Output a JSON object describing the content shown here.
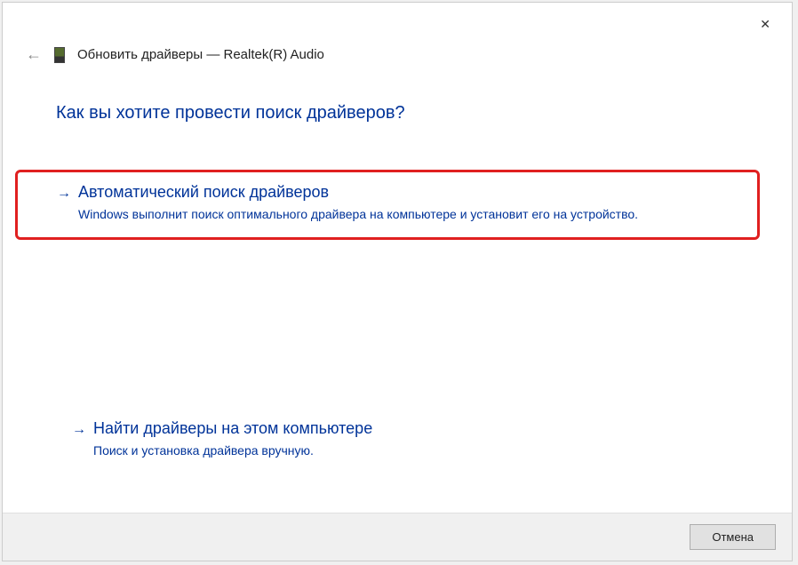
{
  "header": {
    "title": "Обновить драйверы — Realtek(R) Audio"
  },
  "question": "Как вы хотите провести поиск драйверов?",
  "options": [
    {
      "title": "Автоматический поиск драйверов",
      "description": "Windows выполнит поиск оптимального драйвера на компьютере и установит его на устройство."
    },
    {
      "title": "Найти драйверы на этом компьютере",
      "description": "Поиск и установка драйвера вручную."
    }
  ],
  "footer": {
    "cancel_label": "Отмена"
  }
}
